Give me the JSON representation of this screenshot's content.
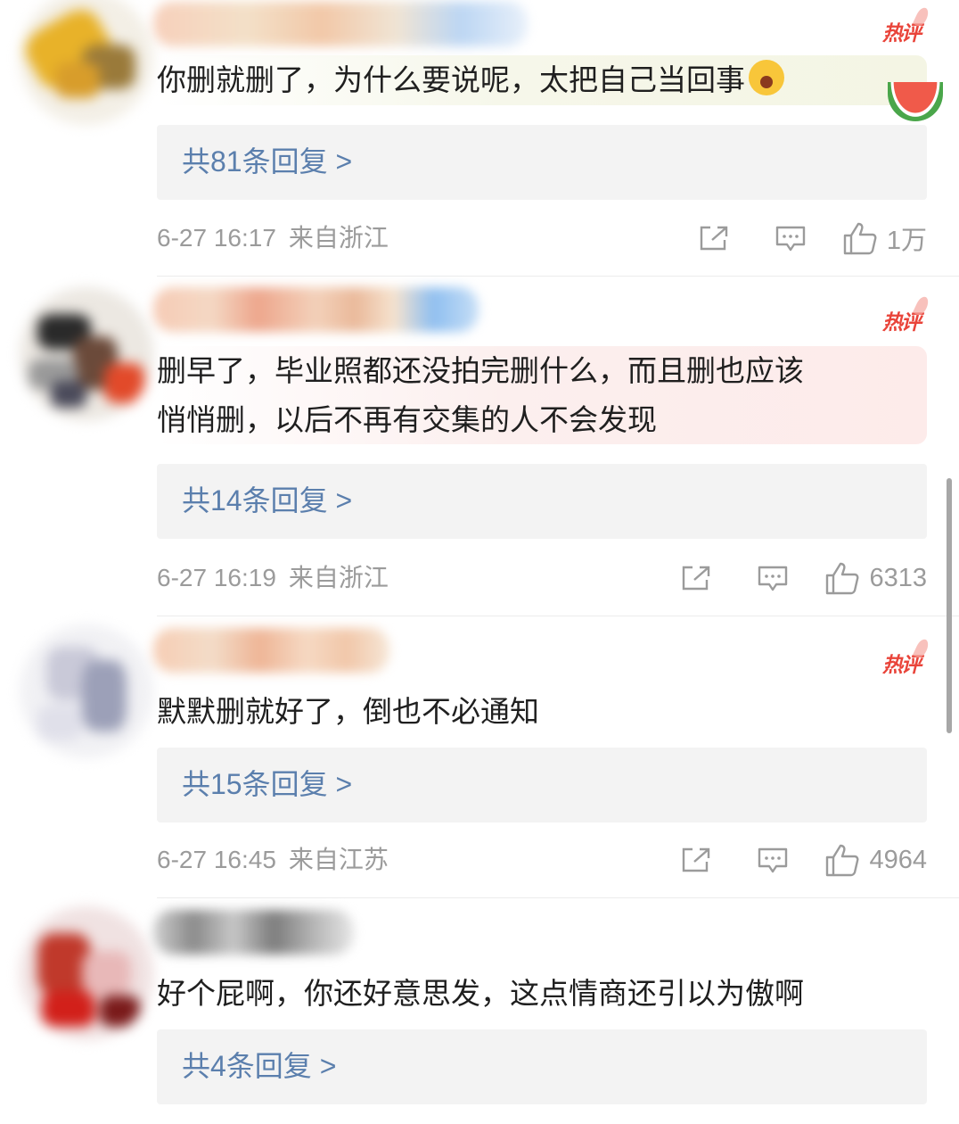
{
  "comments": [
    {
      "hot_badge": "热评",
      "text": "你删就删了，为什么要说呢，太把自己当回事",
      "replies": "共81条回复 >",
      "time": "6-27 16:17",
      "location": "来自浙江",
      "likes": "1万"
    },
    {
      "hot_badge": "热评",
      "text_line1": "删早了，毕业照都还没拍完删什么，而且删也应该",
      "text_line2": "悄悄删，以后不再有交集的人不会发现",
      "replies": "共14条回复 >",
      "time": "6-27 16:19",
      "location": "来自浙江",
      "likes": "6313"
    },
    {
      "hot_badge": "热评",
      "text": "默默删就好了，倒也不必通知",
      "replies": "共15条回复 >",
      "time": "6-27 16:45",
      "location": "来自江苏",
      "likes": "4964"
    },
    {
      "text": "好个屁啊，你还好意思发，这点情商还引以为傲啊",
      "replies": "共4条回复 >"
    }
  ],
  "icons": {
    "share": "share-icon",
    "comment": "comment-icon",
    "like": "thumbs-up-icon",
    "emoji": "crying-face-emoji-icon",
    "sticker": "watermelon-sticker-icon"
  },
  "colors": {
    "hot_badge": "#e9443a",
    "reply_link": "#5b7fad",
    "meta_text": "#9b9b9b",
    "reply_box_bg": "#f3f3f3"
  }
}
